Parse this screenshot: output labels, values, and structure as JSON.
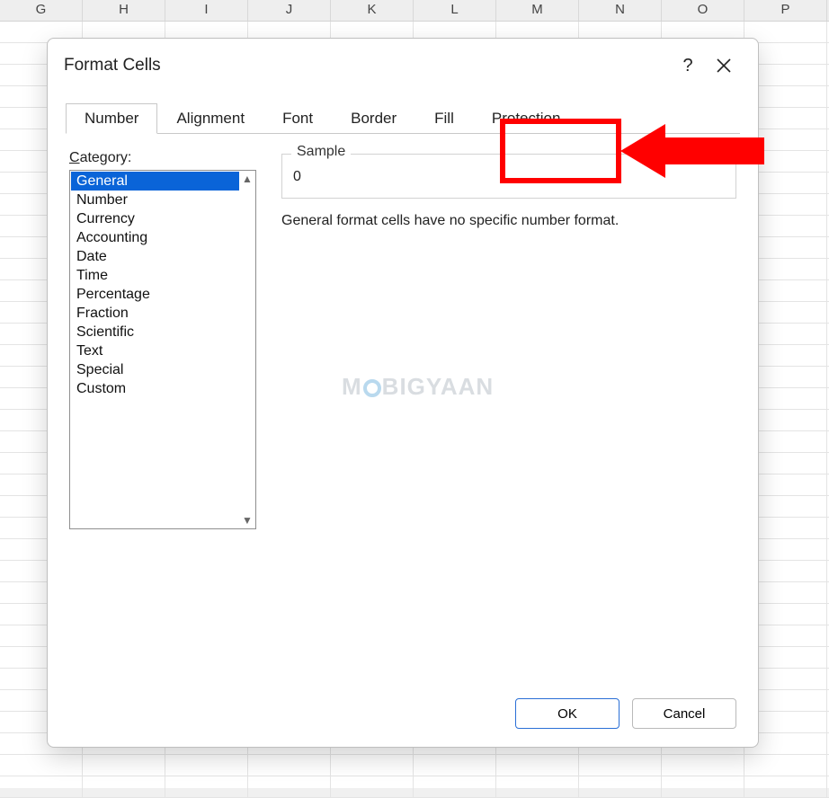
{
  "columns": [
    "G",
    "H",
    "I",
    "J",
    "K",
    "L",
    "M",
    "N",
    "O",
    "P"
  ],
  "dialog": {
    "title": "Format Cells",
    "help_label": "?",
    "close_label": "✕",
    "tabs": [
      {
        "label": "Number",
        "active": true
      },
      {
        "label": "Alignment",
        "active": false
      },
      {
        "label": "Font",
        "active": false
      },
      {
        "label": "Border",
        "active": false
      },
      {
        "label": "Fill",
        "active": false
      },
      {
        "label": "Protection",
        "active": false
      }
    ],
    "category_label_prefix": "C",
    "category_label_rest": "ategory:",
    "categories": [
      "General",
      "Number",
      "Currency",
      "Accounting",
      "Date",
      "Time",
      "Percentage",
      "Fraction",
      "Scientific",
      "Text",
      "Special",
      "Custom"
    ],
    "selected_category_index": 0,
    "sample_label": "Sample",
    "sample_value": "0",
    "description": "General format cells have no specific number format.",
    "ok_label": "OK",
    "cancel_label": "Cancel"
  },
  "watermark": {
    "pre": "M",
    "post": "BIGYAAN"
  },
  "annotation": {
    "highlight_tab": "Protection"
  }
}
